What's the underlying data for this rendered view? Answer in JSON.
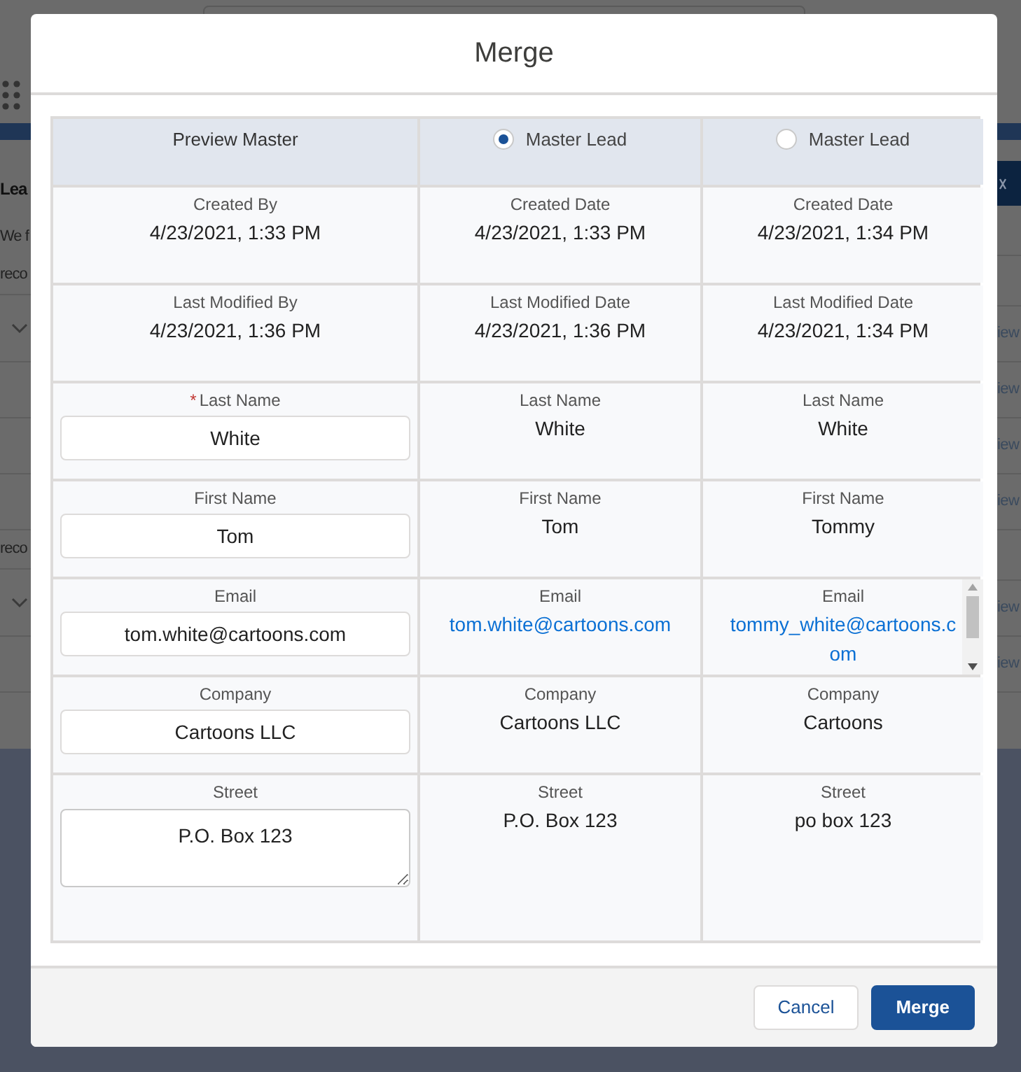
{
  "background": {
    "left": [
      {
        "kind": "title",
        "text": "Lea"
      },
      {
        "kind": "note",
        "text": "We f"
      },
      {
        "kind": "section",
        "text": "reco"
      },
      {
        "kind": "toggle"
      },
      {
        "kind": "row"
      },
      {
        "kind": "row"
      },
      {
        "kind": "row"
      },
      {
        "kind": "section",
        "text": "reco"
      },
      {
        "kind": "toggle"
      },
      {
        "kind": "row"
      }
    ],
    "right": [
      {
        "kind": "header"
      },
      {
        "kind": "blank"
      },
      {
        "kind": "blank"
      },
      {
        "kind": "link",
        "text": "iew"
      },
      {
        "kind": "link",
        "text": "iew"
      },
      {
        "kind": "link",
        "text": "iew"
      },
      {
        "kind": "link",
        "text": "iew"
      },
      {
        "kind": "blank"
      },
      {
        "kind": "link",
        "text": "iew"
      },
      {
        "kind": "link",
        "text": "iew"
      }
    ]
  },
  "dialog": {
    "title": "Merge",
    "columns": [
      {
        "kind": "label",
        "label": "Preview Master"
      },
      {
        "kind": "radio",
        "label": "Master Lead",
        "selected": true
      },
      {
        "kind": "radio",
        "label": "Master Lead",
        "selected": false
      }
    ],
    "rows": [
      {
        "kind": "short",
        "cells": [
          {
            "kind": "text",
            "label": "Created By",
            "value": "4/23/2021, 1:33 PM"
          },
          {
            "kind": "text",
            "label": "Created Date",
            "value": "4/23/2021, 1:33 PM"
          },
          {
            "kind": "text",
            "label": "Created Date",
            "value": "4/23/2021, 1:34 PM"
          }
        ]
      },
      {
        "kind": "short",
        "cells": [
          {
            "kind": "text",
            "label": "Last Modified By",
            "value": "4/23/2021, 1:36 PM"
          },
          {
            "kind": "text",
            "label": "Last Modified Date",
            "value": "4/23/2021, 1:36 PM"
          },
          {
            "kind": "text",
            "label": "Last Modified Date",
            "value": "4/23/2021, 1:34 PM"
          }
        ]
      },
      {
        "kind": "short",
        "cells": [
          {
            "kind": "input",
            "label": "Last Name",
            "value": "White",
            "marker": "*"
          },
          {
            "kind": "text",
            "label": "Last Name",
            "value": "White"
          },
          {
            "kind": "text",
            "label": "Last Name",
            "value": "White"
          }
        ]
      },
      {
        "kind": "short",
        "cells": [
          {
            "kind": "input",
            "label": "First Name",
            "value": "Tom"
          },
          {
            "kind": "text",
            "label": "First Name",
            "value": "Tom"
          },
          {
            "kind": "text",
            "label": "First Name",
            "value": "Tommy"
          }
        ]
      },
      {
        "kind": "short",
        "cells": [
          {
            "kind": "input",
            "label": "Email",
            "value": "tom.white@cartoons.com"
          },
          {
            "kind": "link",
            "label": "Email",
            "value": "tom.white@cartoons.com",
            "scrollable": false
          },
          {
            "kind": "link",
            "label": "Email",
            "value": "tommy_white@cartoons.com",
            "scrollable": true
          }
        ]
      },
      {
        "kind": "short",
        "cells": [
          {
            "kind": "input",
            "label": "Company",
            "value": "Cartoons LLC"
          },
          {
            "kind": "text",
            "label": "Company",
            "value": "Cartoons LLC"
          },
          {
            "kind": "text",
            "label": "Company",
            "value": "Cartoons"
          }
        ]
      },
      {
        "kind": "tall",
        "cells": [
          {
            "kind": "textarea",
            "label": "Street",
            "value": "P.O. Box 123"
          },
          {
            "kind": "text",
            "label": "Street",
            "value": "P.O. Box 123"
          },
          {
            "kind": "text",
            "label": "Street",
            "value": "po box 123"
          }
        ]
      }
    ],
    "buttons": [
      {
        "kind": "neutral",
        "label": "Cancel"
      },
      {
        "kind": "brand",
        "label": "Merge"
      }
    ]
  }
}
